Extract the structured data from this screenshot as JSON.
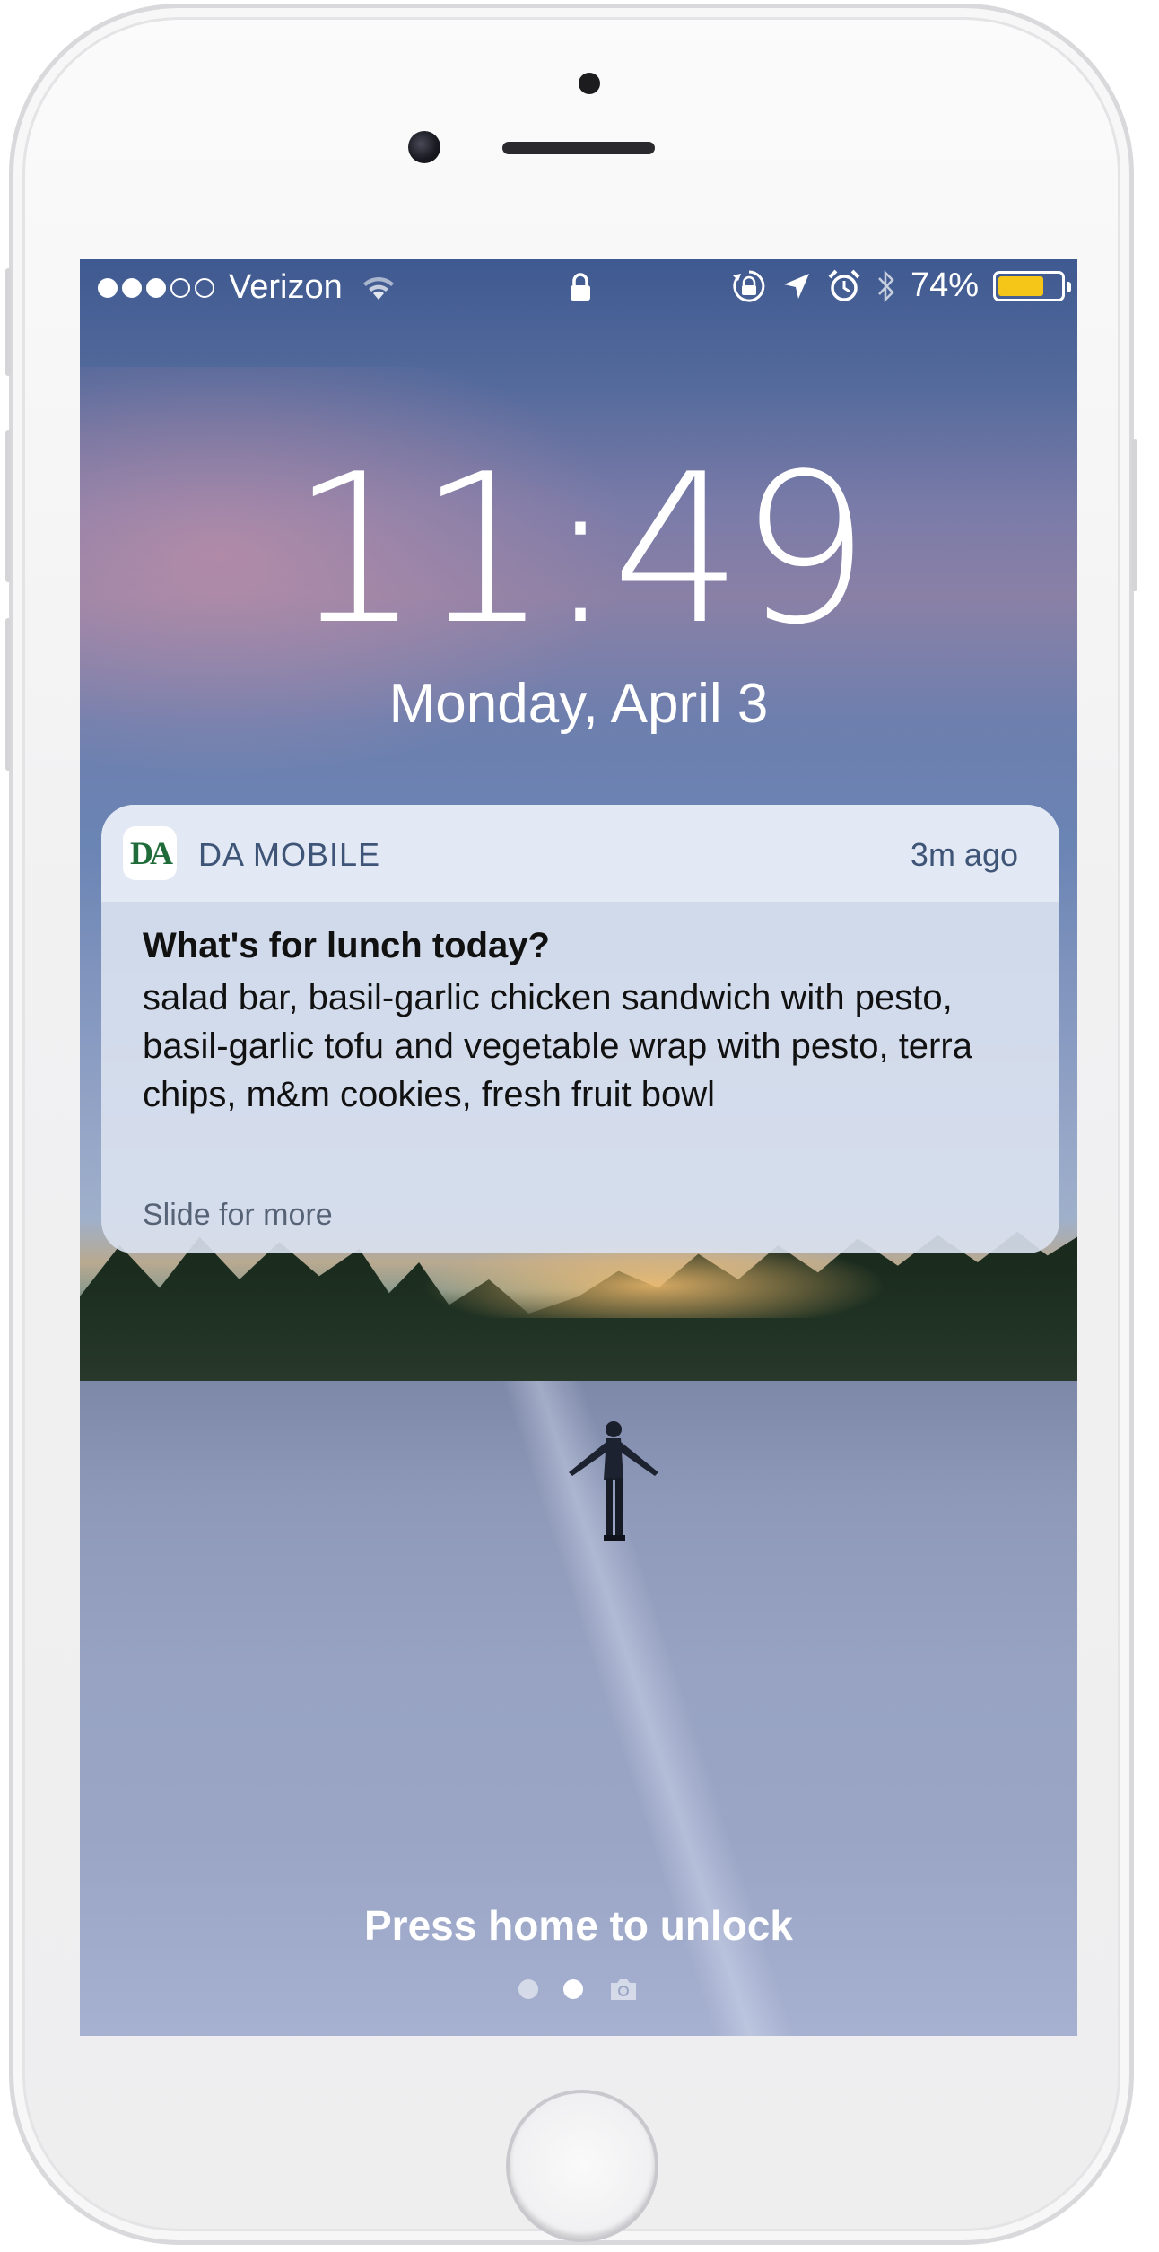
{
  "status_bar": {
    "signal_bars_filled": 3,
    "signal_bars_total": 5,
    "carrier": "Verizon",
    "wifi_icon": "wifi-icon",
    "lock_icon": "padlock-icon",
    "right_icons": [
      "orientation-lock-icon",
      "location-arrow-icon",
      "alarm-icon",
      "bluetooth-icon"
    ],
    "battery_percent": "74%",
    "battery_level": 0.74,
    "battery_color": "#f5c518"
  },
  "lockscreen": {
    "time": "11:49",
    "date": "Monday, April 3",
    "unlock_hint": "Press home to unlock",
    "page_dots": 2,
    "active_page": 1,
    "camera_icon": "camera-icon"
  },
  "notification": {
    "app_icon_text": "DA",
    "app_name": "DA MOBILE",
    "time_ago": "3m ago",
    "title": "What's for lunch today?",
    "body": "salad bar, basil-garlic chicken sandwich with pesto, basil-garlic tofu and vegetable wrap with pesto, terra chips, m&m cookies, fresh fruit bowl",
    "footer": "Slide for more"
  }
}
